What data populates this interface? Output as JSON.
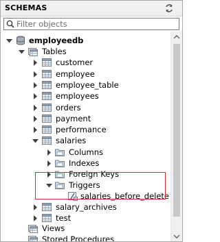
{
  "header": {
    "title": "SCHEMAS",
    "refresh_icon": "refresh-icon"
  },
  "filter": {
    "placeholder": "Filter objects",
    "value": ""
  },
  "tree": {
    "schema": "employeedb",
    "tables_folder": "Tables",
    "tables": [
      "customer",
      "employee",
      "employee_table",
      "employees",
      "orders",
      "payment",
      "performance",
      "salaries"
    ],
    "salaries_children": [
      "Columns",
      "Indexes",
      "Foreign Keys",
      "Triggers"
    ],
    "trigger": "salaries_before_delete",
    "tables_after": [
      "salary_archives",
      "test"
    ],
    "views_folder": "Views",
    "procedures_folder": "Stored Procedures"
  },
  "colors": {
    "highlight": "#c9303a",
    "folder": "#e6b84a",
    "table_icon": "#7a8a99"
  }
}
